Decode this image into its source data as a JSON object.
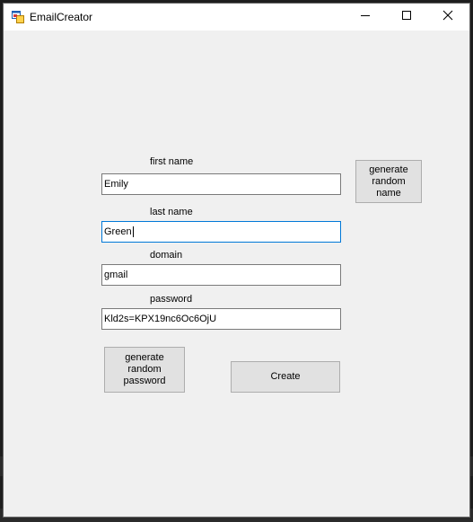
{
  "window": {
    "title": "EmailCreator",
    "icons": {
      "app": "form-icon",
      "minimize": "minimize-icon",
      "maximize": "maximize-icon",
      "close": "close-icon"
    }
  },
  "form": {
    "first_name": {
      "label": "first name",
      "value": "Emily"
    },
    "last_name": {
      "label": "last name",
      "value": "Green"
    },
    "domain": {
      "label": "domain",
      "value": "gmail"
    },
    "password": {
      "label": "password",
      "value": "Kld2s=KPX19nc6Oc6OjU"
    }
  },
  "buttons": {
    "generate_random_name": "generate\nrandom\nname",
    "generate_random_password": "generate\nrandom\npassword",
    "create": "Create"
  },
  "colors": {
    "window_bg": "#f0f0f0",
    "button_bg": "#e1e1e1",
    "focus_border": "#0078d7"
  }
}
